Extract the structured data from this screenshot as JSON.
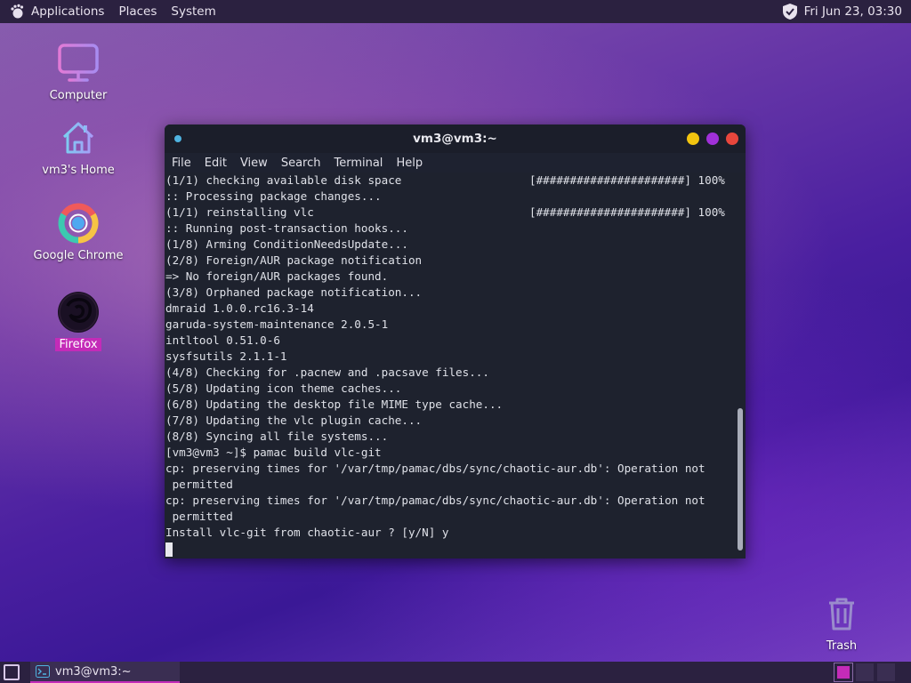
{
  "top_panel": {
    "menus": [
      "Applications",
      "Places",
      "System"
    ],
    "clock": "Fri Jun 23, 03:30"
  },
  "desktop": {
    "icons": [
      {
        "label": "Computer",
        "icon": "computer-icon"
      },
      {
        "label": "vm3's Home",
        "icon": "home-folder-icon"
      },
      {
        "label": "Google Chrome",
        "icon": "chrome-icon"
      },
      {
        "label": "Firefox",
        "icon": "firefox-icon",
        "selected": true
      },
      {
        "label": "Trash",
        "icon": "trash-icon"
      }
    ]
  },
  "terminal": {
    "title": "vm3@vm3:~",
    "menu": [
      "File",
      "Edit",
      "View",
      "Search",
      "Terminal",
      "Help"
    ],
    "lines": [
      {
        "text": "(1/1) checking available disk space",
        "progress": "[######################] 100%"
      },
      {
        "text": ":: Processing package changes..."
      },
      {
        "text": "(1/1) reinstalling vlc",
        "progress": "[######################] 100%"
      },
      {
        "text": ":: Running post-transaction hooks..."
      },
      {
        "text": "(1/8) Arming ConditionNeedsUpdate..."
      },
      {
        "text": "(2/8) Foreign/AUR package notification"
      },
      {
        "text": "=> No foreign/AUR packages found."
      },
      {
        "text": "(3/8) Orphaned package notification..."
      },
      {
        "text": "dmraid 1.0.0.rc16.3-14"
      },
      {
        "text": "garuda-system-maintenance 2.0.5-1"
      },
      {
        "text": "intltool 0.51.0-6"
      },
      {
        "text": "sysfsutils 2.1.1-1"
      },
      {
        "text": "(4/8) Checking for .pacnew and .pacsave files..."
      },
      {
        "text": "(5/8) Updating icon theme caches..."
      },
      {
        "text": "(6/8) Updating the desktop file MIME type cache..."
      },
      {
        "text": "(7/8) Updating the vlc plugin cache..."
      },
      {
        "text": "(8/8) Syncing all file systems..."
      },
      {
        "text": "[vm3@vm3 ~]$ pamac build vlc-git"
      },
      {
        "text": "cp: preserving times for '/var/tmp/pamac/dbs/sync/chaotic-aur.db': Operation not"
      },
      {
        "text": " permitted"
      },
      {
        "text": "cp: preserving times for '/var/tmp/pamac/dbs/sync/chaotic-aur.db': Operation not"
      },
      {
        "text": " permitted"
      },
      {
        "text": "Install vlc-git from chaotic-aur ? [y/N] y"
      }
    ],
    "colors": {
      "close": "#e8463c",
      "maximize": "#a030d8",
      "minimize": "#f2c40f",
      "dot": "#4fb3e0"
    }
  },
  "taskbar": {
    "task_label": "vm3@vm3:~",
    "accent": "#c42bb8"
  }
}
